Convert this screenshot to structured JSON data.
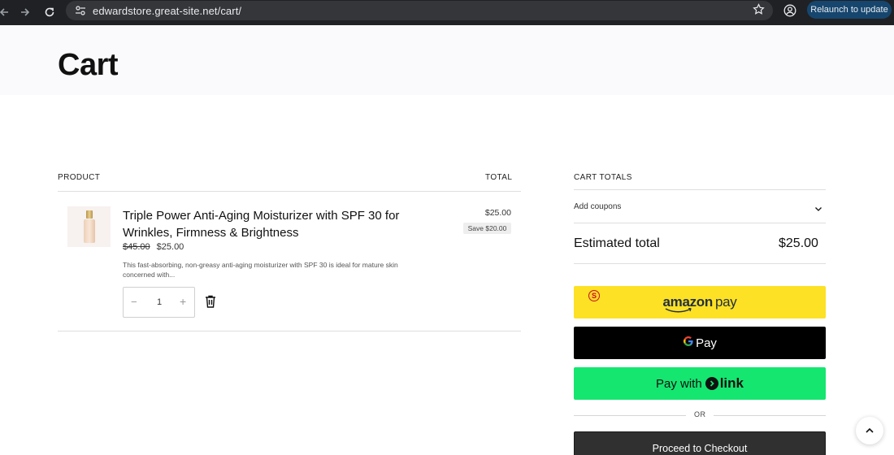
{
  "browser": {
    "url": "edwardstore.great-site.net/cart/",
    "relaunch_label": "Relaunch to update"
  },
  "page": {
    "title": "Cart"
  },
  "cart_table": {
    "head_product": "PRODUCT",
    "head_total": "TOTAL",
    "item": {
      "name": "Triple Power Anti-Aging Moisturizer with SPF 30 for Wrinkles, Firmness & Brightness",
      "regular_price": "$45.00",
      "sale_price": "$25.00",
      "description": "This fast-absorbing, non-greasy anti-aging moisturizer with SPF 30 is ideal for mature skin concerned with...",
      "quantity": "1",
      "minus": "−",
      "plus": "+",
      "line_total": "$25.00",
      "save_badge": "Save $20.00"
    }
  },
  "totals": {
    "heading": "CART TOTALS",
    "coupon_label": "Add coupons",
    "estimated_label": "Estimated total",
    "estimated_value": "$25.00",
    "amazon_brand": "amazon",
    "amazon_pay": "pay",
    "amazon_badge": "S",
    "gpay_g": "G",
    "gpay_text": "Pay",
    "link_prefix": "Pay with",
    "link_brand": "link",
    "or_text": "OR",
    "checkout_label": "Proceed to Checkout"
  },
  "colors": {
    "amazon_yellow": "#fde124",
    "link_green": "#14e670",
    "checkout_bg": "#303030",
    "chrome_bg": "#202124"
  }
}
